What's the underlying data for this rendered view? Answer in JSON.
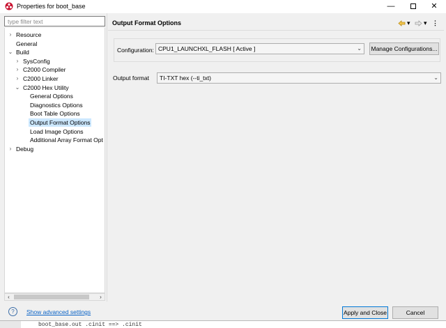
{
  "window": {
    "title": "Properties for boot_base"
  },
  "filter": {
    "placeholder": "type filter text"
  },
  "tree": [
    {
      "label": "Resource",
      "twisty": "›",
      "name": "tree-item-resource"
    },
    {
      "label": "General",
      "twisty": "",
      "name": "tree-item-general"
    },
    {
      "label": "Build",
      "twisty": "⌄",
      "name": "tree-item-build"
    },
    {
      "label": "SysConfig",
      "twisty": "›",
      "name": "tree-item-sysconfig"
    },
    {
      "label": "C2000 Compiler",
      "twisty": "›",
      "name": "tree-item-c2000-compiler"
    },
    {
      "label": "C2000 Linker",
      "twisty": "›",
      "name": "tree-item-c2000-linker"
    },
    {
      "label": "C2000 Hex Utility",
      "twisty": "⌄",
      "name": "tree-item-c2000-hex-utility"
    },
    {
      "label": "General Options",
      "twisty": "",
      "name": "tree-item-general-options"
    },
    {
      "label": "Diagnostics Options",
      "twisty": "",
      "name": "tree-item-diagnostics-options"
    },
    {
      "label": "Boot Table Options",
      "twisty": "",
      "name": "tree-item-boot-table-options"
    },
    {
      "label": "Output Format Options",
      "twisty": "",
      "name": "tree-item-output-format-options",
      "selected": true
    },
    {
      "label": "Load Image Options",
      "twisty": "",
      "name": "tree-item-load-image-options"
    },
    {
      "label": "Additional Array Format Opt",
      "twisty": "",
      "name": "tree-item-additional-array-format-options"
    },
    {
      "label": "Debug",
      "twisty": "›",
      "name": "tree-item-debug"
    }
  ],
  "page": {
    "title": "Output Format Options",
    "nav_icons": [
      "back-arrow-icon",
      "chevron-down-icon",
      "forward-arrow-icon",
      "chevron-down-icon",
      "more-vertical-icon"
    ]
  },
  "configuration": {
    "label": "Configuration:",
    "value": "CPU1_LAUNCHXL_FLASH  [ Active ]",
    "manage_label": "Manage Configurations..."
  },
  "output_format": {
    "label": "Output format",
    "value": "TI-TXT hex (--ti_txt)"
  },
  "footer": {
    "advanced_link": "Show advanced settings",
    "apply_label": "Apply and Close",
    "cancel_label": "Cancel"
  },
  "background": {
    "text": "boot_base.out  .cinit ==> .cinit"
  },
  "colors": {
    "selection": "#cce8ff",
    "link": "#0a63c6",
    "accent": "#0078d7"
  }
}
